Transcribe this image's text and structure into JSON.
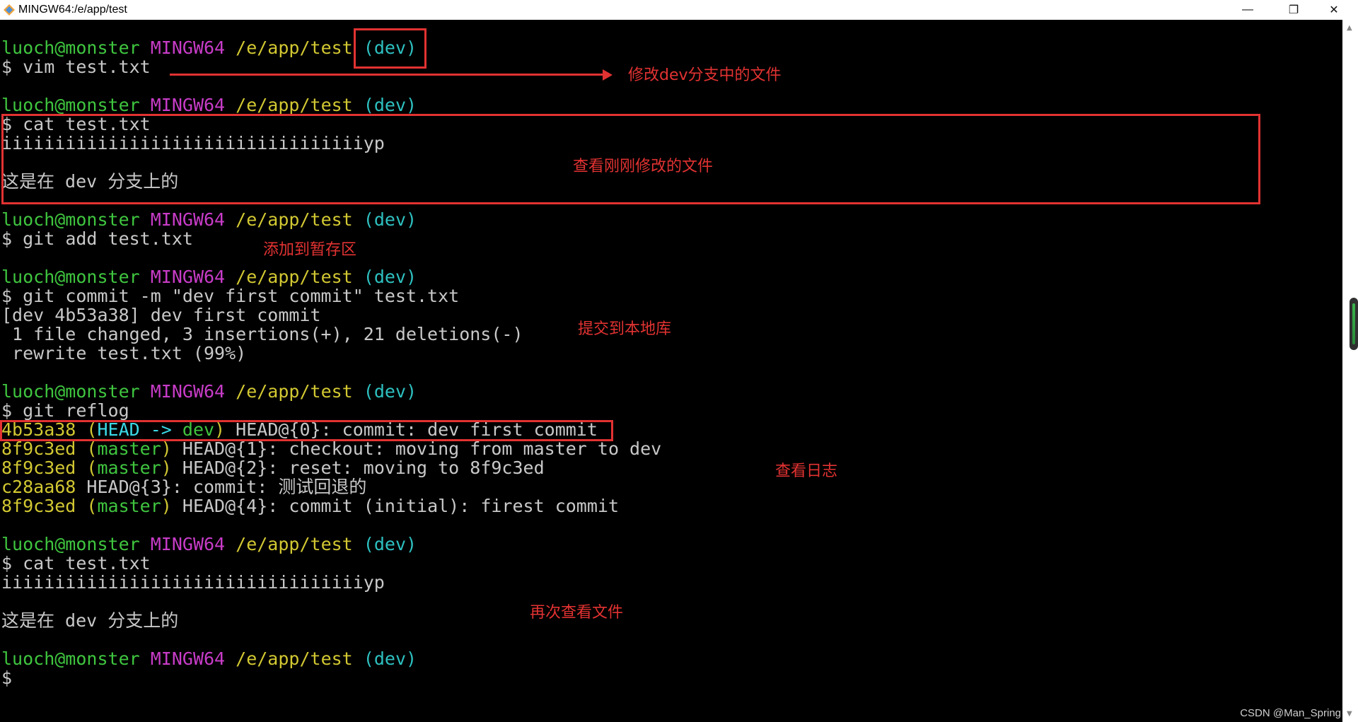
{
  "window": {
    "title": "MINGW64:/e/app/test",
    "minimize_glyph": "—",
    "restore_glyph": "❐",
    "close_glyph": "✕",
    "app_icon": "git-bash-icon"
  },
  "prompt": {
    "user_host": "luoch@monster",
    "shell": "MINGW64",
    "path": "/e/app/test",
    "branch": "(dev)",
    "symbol": "$"
  },
  "terminal": {
    "cmd1": " vim test.txt",
    "cmd2": " cat test.txt",
    "file_line1": "iiiiiiiiiiiiiiiiiiiiiiiiiiiiiiiiiiyp",
    "file_line2": "这是在 dev 分支上的",
    "cmd3": " git add test.txt",
    "cmd4": " git commit -m \"dev first commit\" test.txt",
    "commit_out1": "[dev 4b53a38] dev first commit",
    "commit_out2": " 1 file changed, 3 insertions(+), 21 deletions(-)",
    "commit_out3": " rewrite test.txt (99%)",
    "cmd5": " git reflog",
    "reflog": [
      {
        "hash": "4b53a38",
        "ref_open": " (",
        "ref_head": "HEAD -> ",
        "ref_name": "dev",
        "ref_close": ")",
        "rest": " HEAD@{0}: commit: dev first commit"
      },
      {
        "hash": "8f9c3ed",
        "ref_open": " (",
        "ref_head": "",
        "ref_name": "master",
        "ref_close": ")",
        "rest": " HEAD@{1}: checkout: moving from master to dev"
      },
      {
        "hash": "8f9c3ed",
        "ref_open": " (",
        "ref_head": "",
        "ref_name": "master",
        "ref_close": ")",
        "rest": " HEAD@{2}: reset: moving to 8f9c3ed"
      },
      {
        "hash": "c28aa68",
        "ref_open": "",
        "ref_head": "",
        "ref_name": "",
        "ref_close": "",
        "rest": " HEAD@{3}: commit: 测试回退的"
      },
      {
        "hash": "8f9c3ed",
        "ref_open": " (",
        "ref_head": "",
        "ref_name": "master",
        "ref_close": ")",
        "rest": " HEAD@{4}: commit (initial): firest commit"
      }
    ],
    "cmd6": " cat test.txt",
    "file2_line1": "iiiiiiiiiiiiiiiiiiiiiiiiiiiiiiiiiiyp",
    "file2_line2": "这是在 dev 分支上的"
  },
  "annotations": {
    "modify_label": "修改dev分支中的文件",
    "view_modified_label": "查看刚刚修改的文件",
    "add_stage_label": "添加到暂存区",
    "commit_local_label": "提交到本地库",
    "view_log_label": "查看日志",
    "view_again_label": "再次查看文件"
  },
  "watermark": "CSDN @Man_Spring",
  "scrollbar": {
    "up_glyph": "▲",
    "down_glyph": "▼"
  },
  "colors": {
    "prompt_user": "#3fc53f",
    "prompt_shell": "#c83cc8",
    "prompt_path": "#d2c832",
    "prompt_branch": "#2ec0c0",
    "annotation": "#e23232",
    "terminal_bg": "#000000"
  }
}
